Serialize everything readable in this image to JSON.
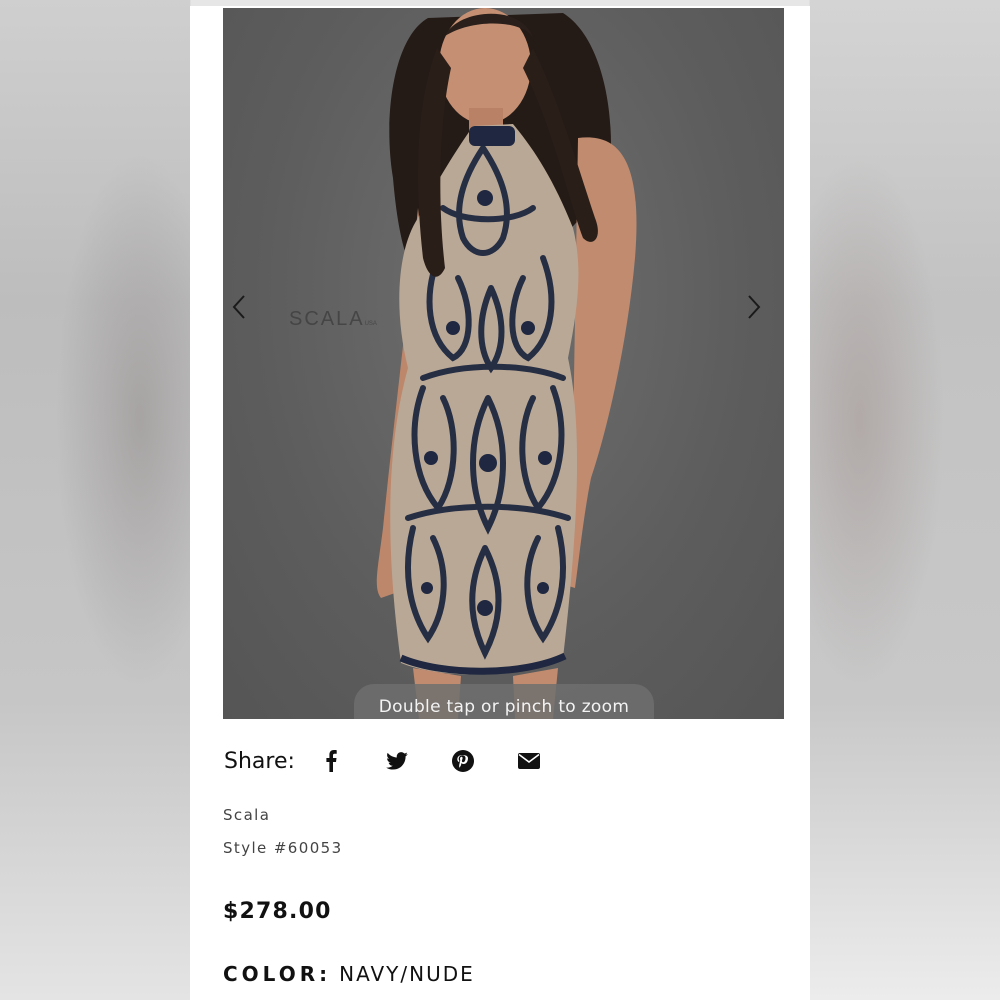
{
  "product": {
    "image_watermark": "SCALA",
    "image_watermark_suffix": "USA",
    "zoom_hint": "Double tap or pinch to zoom",
    "brand": "Scala",
    "style": "Style #60053",
    "price": "$278.00",
    "color_label": "COLOR:",
    "color_value": "NAVY/NUDE"
  },
  "share": {
    "label": "Share:",
    "icons": [
      "facebook-icon",
      "twitter-icon",
      "pinterest-icon",
      "email-icon"
    ]
  },
  "colors": {
    "image_background": "#5d5d5d",
    "dress_navy": "#1f2840",
    "dress_nude": "#b9a896",
    "text": "#111111"
  }
}
